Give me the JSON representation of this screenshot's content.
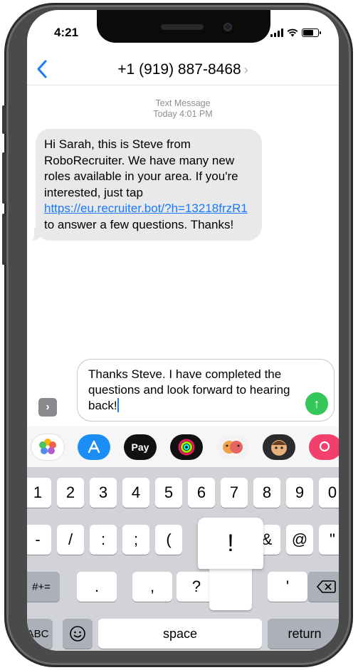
{
  "status_bar": {
    "time": "4:21"
  },
  "header": {
    "contact": "+1 (919) 887-8468",
    "chevron": "›"
  },
  "conversation": {
    "meta_type": "Text Message",
    "meta_time": "Today 4:01 PM",
    "incoming_text_before": "Hi Sarah, this is Steve from RoboRecruiter. We have many new roles available in your area. If you're interested, just tap ",
    "incoming_link": "https://eu.recruiter.bot/?h=13218frzR1",
    "incoming_text_after": " to answer a few questions. Thanks!"
  },
  "composer": {
    "text": "Thanks Steve. I have completed the questions and look forward to hearing back!",
    "apps_button": "›",
    "send_icon": "↑"
  },
  "app_strip": {
    "items": [
      {
        "name": "photos-app-icon",
        "label": ""
      },
      {
        "name": "app-store-icon",
        "label": ""
      },
      {
        "name": "apple-pay-icon",
        "label": "Pay"
      },
      {
        "name": "activity-app-icon",
        "label": ""
      },
      {
        "name": "memoji-stickers-icon",
        "label": ""
      },
      {
        "name": "animoji-icon",
        "label": ""
      },
      {
        "name": "image-search-icon",
        "label": ""
      }
    ]
  },
  "keyboard": {
    "row1": [
      "1",
      "2",
      "3",
      "4",
      "5",
      "6",
      "7",
      "8",
      "9",
      "0"
    ],
    "row2": [
      "-",
      "/",
      ":",
      ";",
      "(",
      ")",
      "$",
      "&",
      "@",
      "\""
    ],
    "popup_key": "!",
    "row3_left": "#+=",
    "row3": [
      ".",
      ",",
      "?",
      "!",
      "'"
    ],
    "row4_abc": "ABC",
    "row4_space": "space",
    "row4_return": "return"
  },
  "colors": {
    "link": "#1a7af8",
    "send": "#34c759",
    "bubble_incoming": "#e9e9eb",
    "keyboard_bg": "#d1d3d9"
  }
}
